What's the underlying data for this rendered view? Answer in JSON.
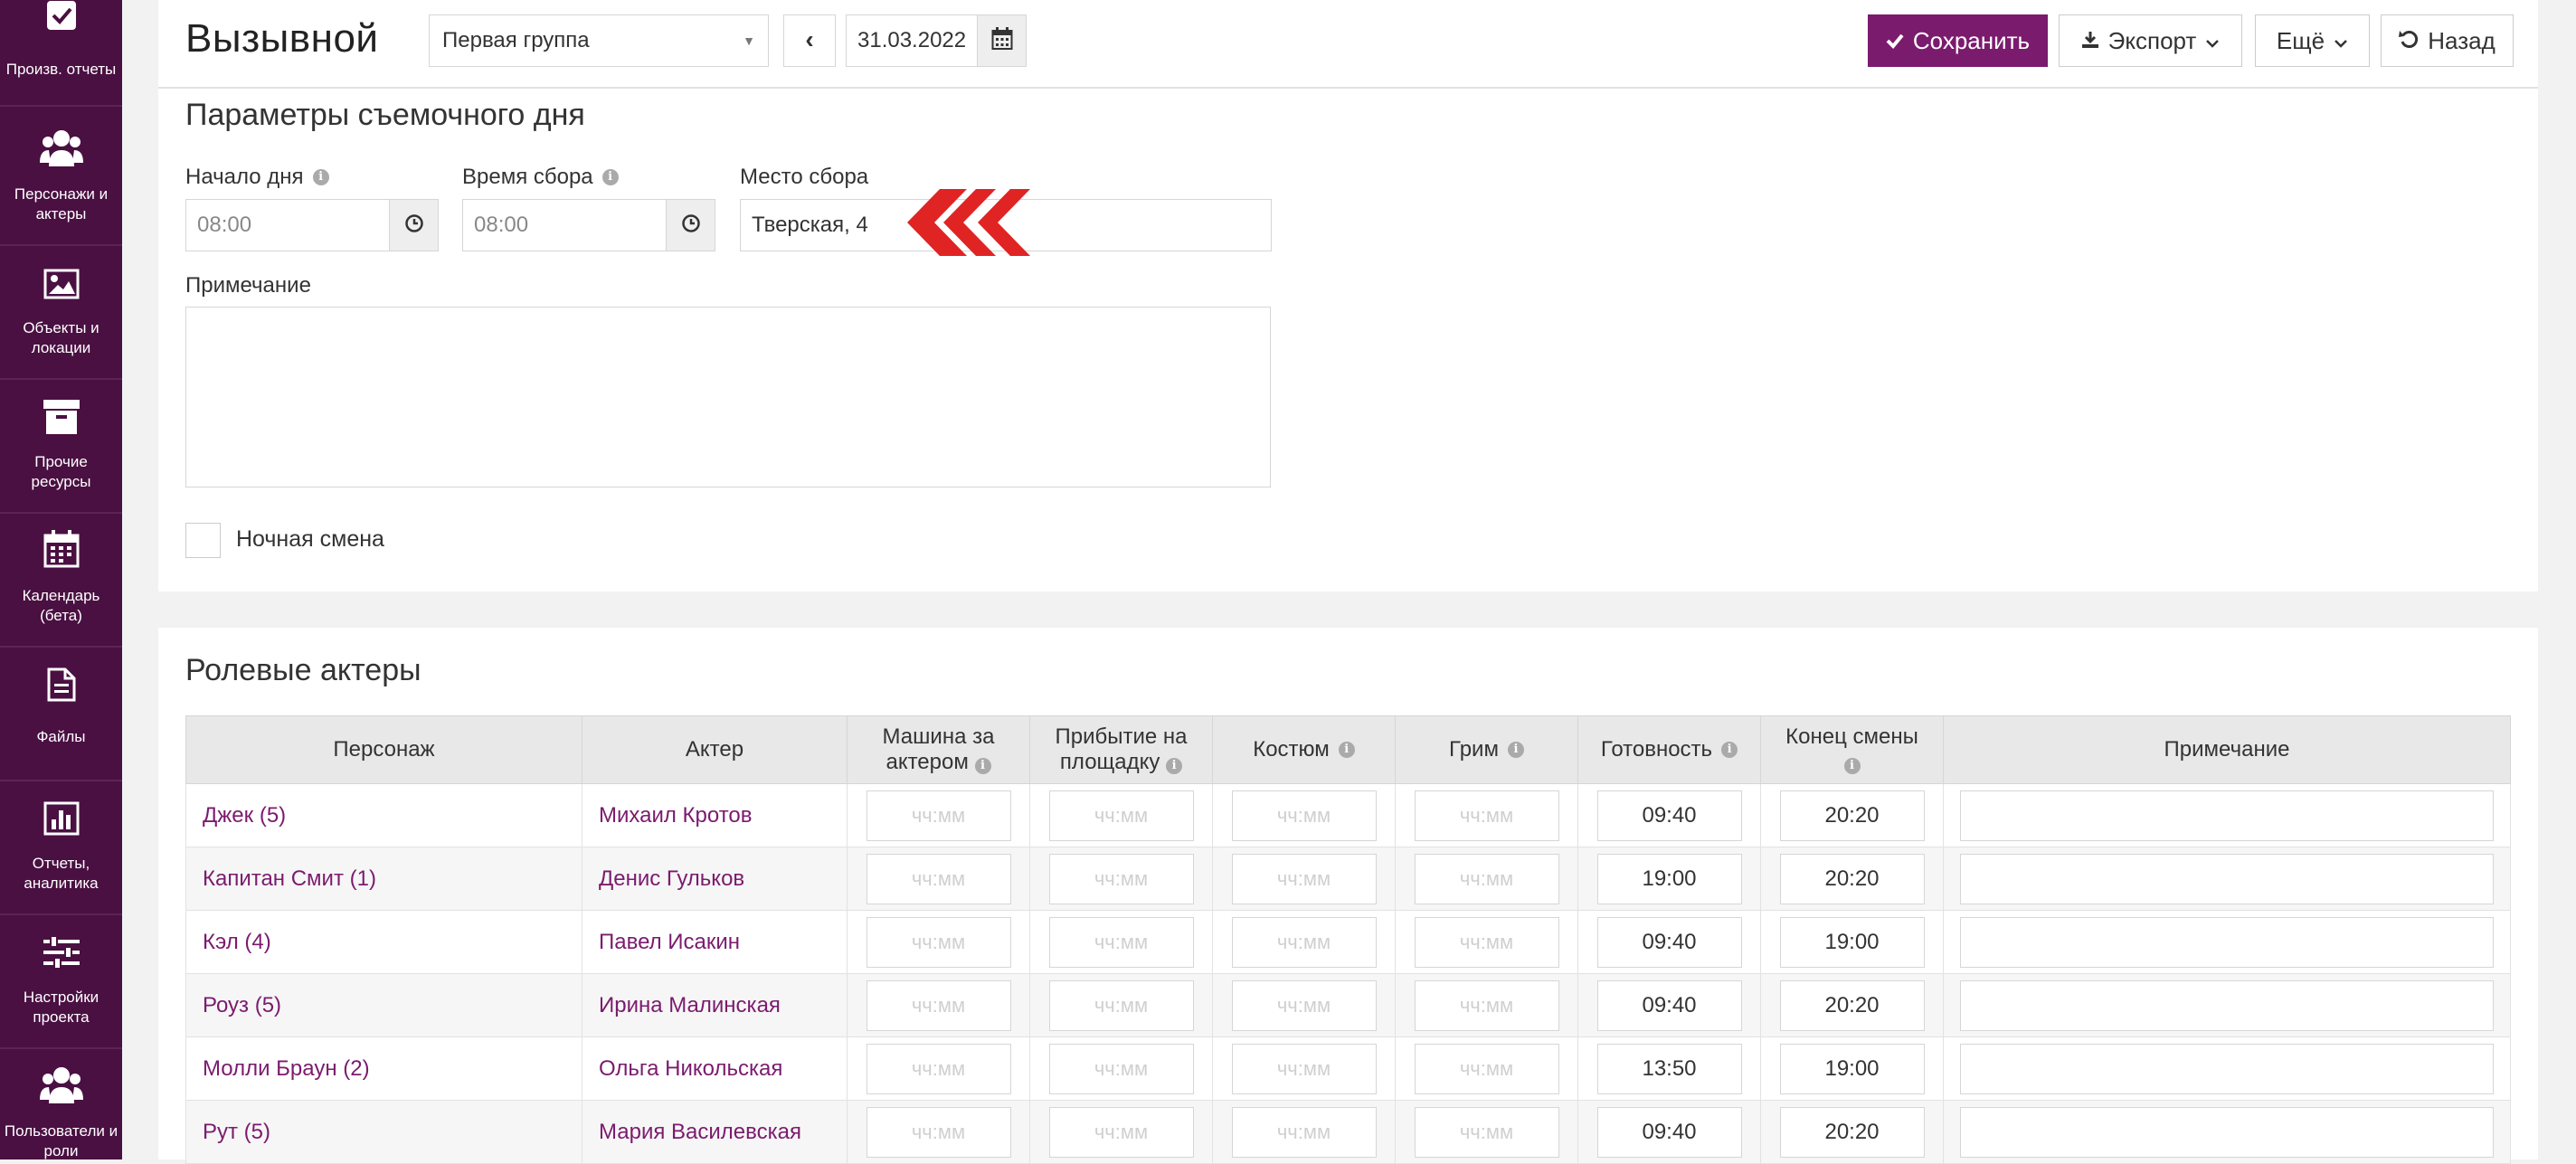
{
  "sidebar": {
    "items": [
      {
        "label": "Произв. отчеты",
        "icon": "checkbox-icon"
      },
      {
        "label": "Персонажи и\nактеры",
        "icon": "users-icon"
      },
      {
        "label": "Объекты и\nлокации",
        "icon": "image-icon"
      },
      {
        "label": "Прочие\nресурсы",
        "icon": "archive-icon"
      },
      {
        "label": "Календарь\n(бета)",
        "icon": "calendar-icon"
      },
      {
        "label": "Файлы",
        "icon": "file-icon"
      },
      {
        "label": "Отчеты,\nаналитика",
        "icon": "bar-chart-icon"
      },
      {
        "label": "Настройки\nпроекта",
        "icon": "sliders-icon"
      },
      {
        "label": "Пользователи и\nроли",
        "icon": "users-icon"
      }
    ],
    "colors": {
      "background": "#4a1042",
      "text": "#ffffff"
    }
  },
  "header": {
    "title": "Вызывной",
    "group_select": "Первая группа",
    "date": "31.03.2022",
    "save": "Сохранить",
    "export": "Экспорт",
    "more": "Ещё",
    "back": "Назад"
  },
  "params": {
    "title": "Параметры съемочного дня",
    "day_start_label": "Начало дня",
    "day_start": "08:00",
    "gather_time_label": "Время сбора",
    "gather_time": "08:00",
    "gather_place_label": "Место сбора",
    "gather_place": "Тверская, 4",
    "note_label": "Примечание",
    "night_shift_label": "Ночная смена"
  },
  "actors": {
    "title": "Ролевые актеры",
    "columns": [
      "Персонаж",
      "Актер",
      "Машина за актером",
      "Прибытие на площадку",
      "Костюм",
      "Грим",
      "Готовность",
      "Конец смены",
      "Примечание"
    ],
    "placeholder": "чч:мм",
    "rows": [
      {
        "character": "Джек (5)",
        "actor": "Михаил Кротов",
        "ready": "09:40",
        "end": "20:20"
      },
      {
        "character": "Капитан Смит (1)",
        "actor": "Денис Гульков",
        "ready": "19:00",
        "end": "20:20"
      },
      {
        "character": "Кэл (4)",
        "actor": "Павел Исакин",
        "ready": "09:40",
        "end": "19:00"
      },
      {
        "character": "Роуз (5)",
        "actor": "Ирина Малинская",
        "ready": "09:40",
        "end": "20:20"
      },
      {
        "character": "Молли Браун (2)",
        "actor": "Ольга Никольская",
        "ready": "13:50",
        "end": "19:00"
      },
      {
        "character": "Рут (5)",
        "actor": "Мария Василевская",
        "ready": "09:40",
        "end": "20:20"
      }
    ]
  },
  "colors": {
    "accent": "#7b1b6e",
    "arrow": "#e02424"
  }
}
